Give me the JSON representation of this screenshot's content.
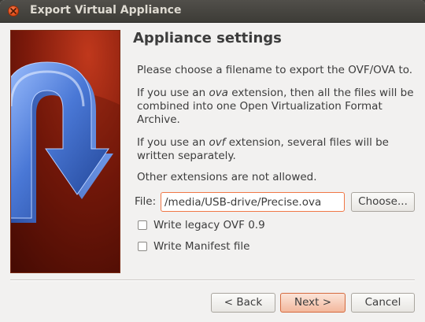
{
  "window": {
    "title": "Export Virtual Appliance"
  },
  "page": {
    "title": "Appliance settings",
    "intro": "Please choose a filename to export the OVF/OVA to.",
    "ova_prefix": "If you use an ",
    "ova_ext": "ova",
    "ova_suffix": " extension, then all the files will be combined into one Open Virtualization Format Archive.",
    "ovf_prefix": "If you use an ",
    "ovf_ext": "ovf",
    "ovf_suffix": " extension, several files will be written separately.",
    "other": "Other extensions are not allowed."
  },
  "file": {
    "label": "File:",
    "value": "/media/USB-drive/Precise.ova",
    "choose_label": "Choose..."
  },
  "options": {
    "legacy_label": "Write legacy OVF 0.9",
    "legacy_checked": false,
    "manifest_label": "Write Manifest file",
    "manifest_checked": false
  },
  "buttons": {
    "back": "< Back",
    "next": "Next >",
    "cancel": "Cancel"
  },
  "icons": {
    "close": "close-icon",
    "wizard_art": "export-arrow-icon"
  },
  "colors": {
    "accent": "#f07746",
    "title_bar": "#3d3c37",
    "banner_red": "#8a1f0c",
    "arrow_blue": "#4a78d6"
  }
}
